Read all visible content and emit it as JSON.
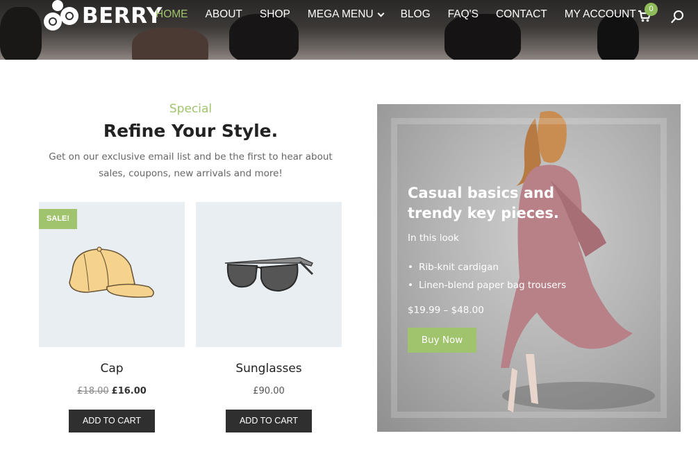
{
  "header": {
    "logo_text": "BERRY",
    "nav": [
      {
        "label": "HOME",
        "active": true
      },
      {
        "label": "ABOUT"
      },
      {
        "label": "SHOP"
      },
      {
        "label": "MEGA MENU",
        "has_dropdown": true
      },
      {
        "label": "BLOG"
      },
      {
        "label": "FAQ'S"
      },
      {
        "label": "CONTACT"
      },
      {
        "label": "MY ACCOUNT"
      }
    ],
    "cart_count": "0",
    "icons": [
      "cart-icon",
      "search-icon"
    ]
  },
  "section": {
    "subtitle": "Special",
    "title": "Refine Your Style.",
    "intro": "Get on our exclusive email list and be the first to hear about sales, coupons, new arrivals and more!"
  },
  "products": [
    {
      "name": "Cap",
      "badge": "SALE!",
      "old_price": "£18.00",
      "price": "£16.00",
      "button": "ADD TO CART",
      "icon": "cap-icon"
    },
    {
      "name": "Sunglasses",
      "price": "£90.00",
      "button": "ADD TO CART",
      "icon": "sunglasses-icon"
    }
  ],
  "promo": {
    "title": "Casual basics and trendy key pieces.",
    "look_label": "In this look",
    "items": [
      "Rib-knit cardigan",
      "Linen-blend paper bag trousers"
    ],
    "price_range": "$19.99 – $48.00",
    "button": "Buy Now"
  },
  "colors": {
    "accent": "#a0c46d",
    "button_dark": "#2f2f2f",
    "product_bg": "#e9eef3"
  }
}
